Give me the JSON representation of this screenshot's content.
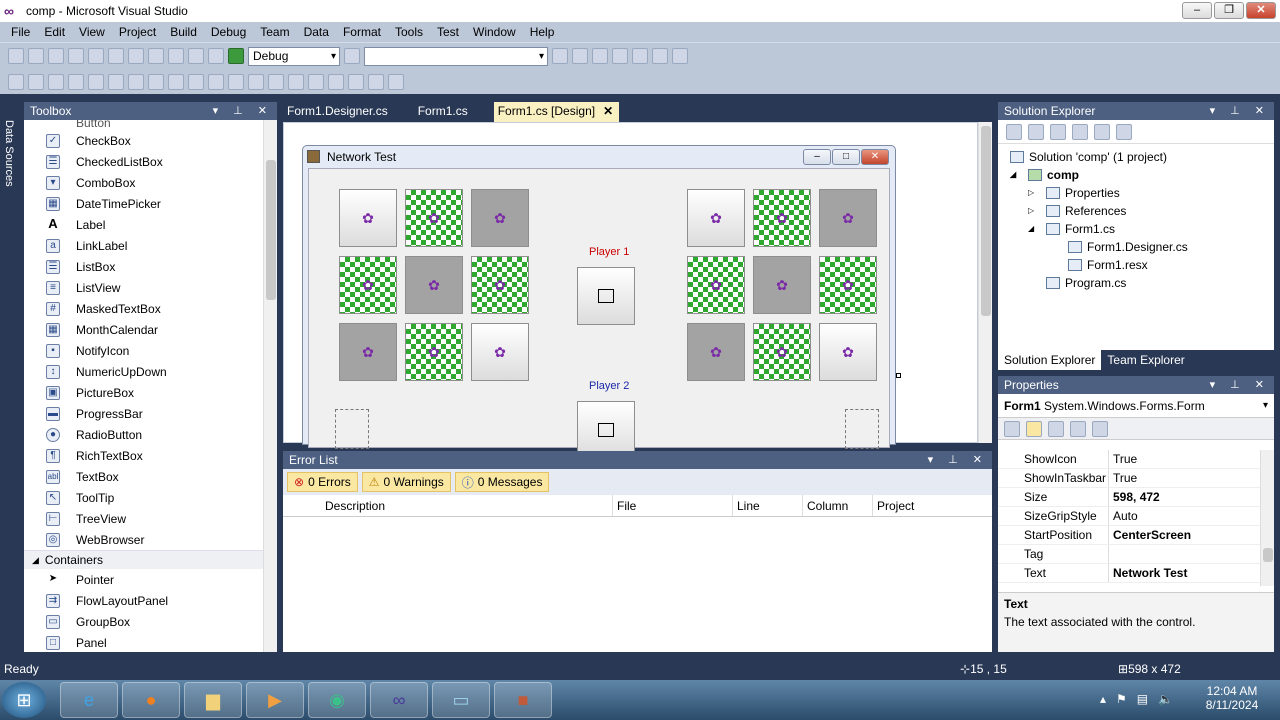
{
  "window": {
    "title": "comp - Microsoft Visual Studio",
    "minimize": "–",
    "maximize": "❐",
    "close": "✕"
  },
  "menu": [
    "File",
    "Edit",
    "View",
    "Project",
    "Build",
    "Debug",
    "Team",
    "Data",
    "Format",
    "Tools",
    "Test",
    "Window",
    "Help"
  ],
  "toolbar": {
    "config_value": "Debug",
    "platform_value": ""
  },
  "sidebar": {
    "label": "Data Sources"
  },
  "toolbox": {
    "title": "Toolbox",
    "partial_item": "Button",
    "items": [
      "CheckBox",
      "CheckedListBox",
      "ComboBox",
      "DateTimePicker",
      "Label",
      "LinkLabel",
      "ListBox",
      "ListView",
      "MaskedTextBox",
      "MonthCalendar",
      "NotifyIcon",
      "NumericUpDown",
      "PictureBox",
      "ProgressBar",
      "RadioButton",
      "RichTextBox",
      "TextBox",
      "ToolTip",
      "TreeView",
      "WebBrowser"
    ],
    "group": "Containers",
    "group_items": [
      "Pointer",
      "FlowLayoutPanel",
      "GroupBox",
      "Panel"
    ]
  },
  "tabs": [
    {
      "label": "Form1.Designer.cs",
      "active": false
    },
    {
      "label": "Form1.cs",
      "active": false
    },
    {
      "label": "Form1.cs [Design]",
      "active": true
    }
  ],
  "form": {
    "title": "Network Test",
    "player1": "Player 1",
    "player2": "Player 2",
    "left_grid": [
      "light",
      "check",
      "gray",
      "check",
      "gray",
      "check",
      "gray",
      "check",
      "light"
    ],
    "right_grid": [
      "light",
      "check",
      "gray",
      "check",
      "gray",
      "check",
      "gray",
      "check",
      "light"
    ],
    "colors": {
      "player1": "#cc0000",
      "player2": "#1a2aa8"
    }
  },
  "solution_explorer": {
    "title": "Solution Explorer",
    "solution": "Solution 'comp' (1 project)",
    "project": "comp",
    "nodes": [
      "Properties",
      "References",
      "Form1.cs",
      "Form1.Designer.cs",
      "Form1.resx",
      "Program.cs"
    ],
    "tab1": "Solution Explorer",
    "tab2": "Team Explorer"
  },
  "properties": {
    "title": "Properties",
    "object": "Form1",
    "object_type": "System.Windows.Forms.Form",
    "rows": [
      {
        "name": "ShowIcon",
        "value": "True"
      },
      {
        "name": "ShowInTaskbar",
        "value": "True"
      },
      {
        "name": "Size",
        "value": "598, 472"
      },
      {
        "name": "SizeGripStyle",
        "value": "Auto"
      },
      {
        "name": "StartPosition",
        "value": "CenterScreen"
      },
      {
        "name": "Tag",
        "value": ""
      },
      {
        "name": "Text",
        "value": "Network Test"
      }
    ],
    "desc_title": "Text",
    "desc_text": "The text associated with the control."
  },
  "error_list": {
    "title": "Error List",
    "errors": "0 Errors",
    "warnings": "0 Warnings",
    "messages": "0 Messages",
    "columns": [
      "Description",
      "File",
      "Line",
      "Column",
      "Project"
    ]
  },
  "status": {
    "text": "Ready",
    "position": "15 , 15",
    "size": "598 x 472"
  },
  "taskbar": {
    "time": "12:04 AM",
    "date": "8/11/2024"
  }
}
